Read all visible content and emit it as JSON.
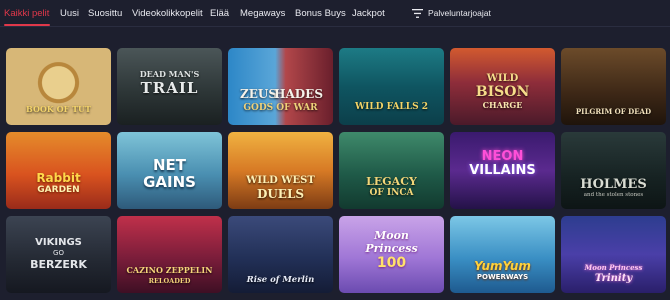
{
  "nav": {
    "tabs": [
      {
        "label": "Kaikki pelit",
        "active": true
      },
      {
        "label": "Uusi"
      },
      {
        "label": "Suosittu"
      },
      {
        "label": "Videokolikkopelit"
      },
      {
        "label": "Elää"
      },
      {
        "label": "Megaways"
      },
      {
        "label": "Bonus Buys"
      },
      {
        "label": "Jackpot"
      }
    ],
    "provider_filter": {
      "label": "Palveluntarjoajat",
      "icon": "filter-lines-icon"
    }
  },
  "games": [
    {
      "name": "Book of Tut",
      "logo": "BOOK OF TUT"
    },
    {
      "name": "Dead Man's Trail",
      "logo_top": "DEAD MAN'S",
      "logo": "TRAIL"
    },
    {
      "name": "Zeus vs Hades Gods of War",
      "logo_top": "ZEUS",
      "logo_mid": "HADES",
      "logo": "GODS OF WAR"
    },
    {
      "name": "Wild Falls 2",
      "logo": "WILD FALLS 2"
    },
    {
      "name": "Wild Bison Charge",
      "logo_top": "WILD",
      "logo_mid": "BISON",
      "logo": "CHARGE"
    },
    {
      "name": "Pilgrim of Dead",
      "logo": "PILGRIM OF DEAD"
    },
    {
      "name": "Rabbit Garden",
      "logo_top": "Rabbit",
      "logo": "GARDEN"
    },
    {
      "name": "Net Gains",
      "logo_top": "NET",
      "logo": "GAINS"
    },
    {
      "name": "Wild West Duels",
      "logo_top": "WILD WEST",
      "logo": "DUELS"
    },
    {
      "name": "Legacy of Inca",
      "logo_top": "LEGACY",
      "logo": "OF INCA"
    },
    {
      "name": "Neon Villains",
      "logo_top": "NEON",
      "logo": "VILLAINS"
    },
    {
      "name": "Holmes and the Stolen Stones",
      "logo": "HOLMES",
      "logo_sub": "and the stolen stones"
    },
    {
      "name": "Vikings Go Berzerk",
      "logo_top": "VIKINGS",
      "logo_mid": "GO",
      "logo": "BERZERK"
    },
    {
      "name": "Cazino Zeppelin Reloaded",
      "logo_top": "CAZINO ZEPPELIN",
      "logo": "RELOADED"
    },
    {
      "name": "Rise of Merlin",
      "logo": "Rise of Merlin"
    },
    {
      "name": "Moon Princess 100",
      "logo_top": "Moon",
      "logo_mid": "Princess",
      "logo": "100"
    },
    {
      "name": "Yum Yum Powerways",
      "logo_top": "YumYum",
      "logo": "POWERWAYS"
    },
    {
      "name": "Moon Princess Trinity",
      "logo_top": "Moon Princess",
      "logo": "Trinity"
    }
  ],
  "colors": {
    "background": "#1d1f2e",
    "accent": "#e0384a",
    "text": "#e9eaf0"
  }
}
